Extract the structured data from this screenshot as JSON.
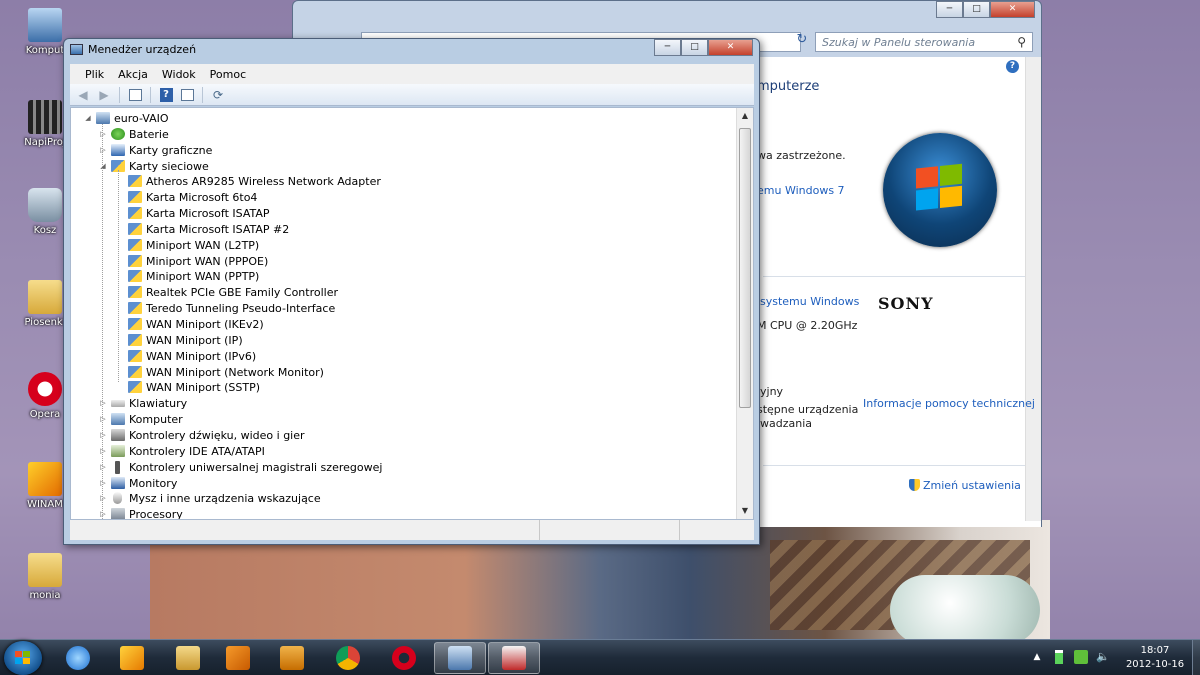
{
  "desktop": {
    "icons": [
      {
        "label": "Komput",
        "icon": "computer-icon"
      },
      {
        "label": "NapiProj",
        "icon": "napiprojekt-icon"
      },
      {
        "label": "Kosz",
        "icon": "recycle-bin-icon"
      },
      {
        "label": "Piosenki",
        "icon": "folder-icon"
      },
      {
        "label": "Opera",
        "icon": "opera-icon"
      },
      {
        "label": "WINAM",
        "icon": "winamp-icon"
      },
      {
        "label": "monia",
        "icon": "folder-icon"
      }
    ]
  },
  "control_panel": {
    "search_placeholder": "Szukaj w Panelu sterowania",
    "heading_fragment": "mputerze",
    "copyright_fragment": "wa zastrzeżone.",
    "link_windows7": "emu Windows 7",
    "link_system": "systemu Windows",
    "cpu_fragment": "M CPU @ 2.20GHz",
    "fragment_yjny": "yjny",
    "fragment_dostepne": "stępne urządzenia",
    "fragment_wadzania": "wadzania",
    "support_link": "Informacje pomocy technicznej",
    "change_settings": "Zmień ustawienia",
    "brand": "SONY"
  },
  "device_manager": {
    "title": "Menedżer urządzeń",
    "menu": [
      "Plik",
      "Akcja",
      "Widok",
      "Pomoc"
    ],
    "root": "euro-VAIO",
    "categories_before": [
      {
        "label": "Baterie",
        "icon": "battery-icon"
      },
      {
        "label": "Karty graficzne",
        "icon": "display-adapter-icon"
      }
    ],
    "expanded_category": "Karty sieciowe",
    "network_adapters": [
      "Atheros AR9285 Wireless Network Adapter",
      "Karta Microsoft 6to4",
      "Karta Microsoft ISATAP",
      "Karta Microsoft ISATAP #2",
      "Miniport WAN (L2TP)",
      "Miniport WAN (PPPOE)",
      "Miniport WAN (PPTP)",
      "Realtek PCIe GBE Family Controller",
      "Teredo Tunneling Pseudo-Interface",
      "WAN Miniport (IKEv2)",
      "WAN Miniport (IP)",
      "WAN Miniport (IPv6)",
      "WAN Miniport (Network Monitor)",
      "WAN Miniport (SSTP)"
    ],
    "categories_after": [
      {
        "label": "Klawiatury",
        "icon": "keyboard-icon"
      },
      {
        "label": "Komputer",
        "icon": "computer-icon"
      },
      {
        "label": "Kontrolery dźwięku, wideo i gier",
        "icon": "sound-icon"
      },
      {
        "label": "Kontrolery IDE ATA/ATAPI",
        "icon": "ide-controller-icon"
      },
      {
        "label": "Kontrolery uniwersalnej magistrali szeregowej",
        "icon": "usb-icon"
      },
      {
        "label": "Monitory",
        "icon": "monitor-icon"
      },
      {
        "label": "Mysz i inne urządzenia wskazujące",
        "icon": "mouse-icon"
      },
      {
        "label": "Procesory",
        "icon": "processor-icon"
      }
    ]
  },
  "taskbar": {
    "apps": [
      "internet-explorer-icon",
      "winamp-icon",
      "explorer-icon",
      "office-icon",
      "media-player-icon",
      "chrome-icon",
      "opera-icon",
      "control-panel-icon",
      "device-manager-icon"
    ],
    "time": "18:07",
    "date": "2012-10-16"
  }
}
